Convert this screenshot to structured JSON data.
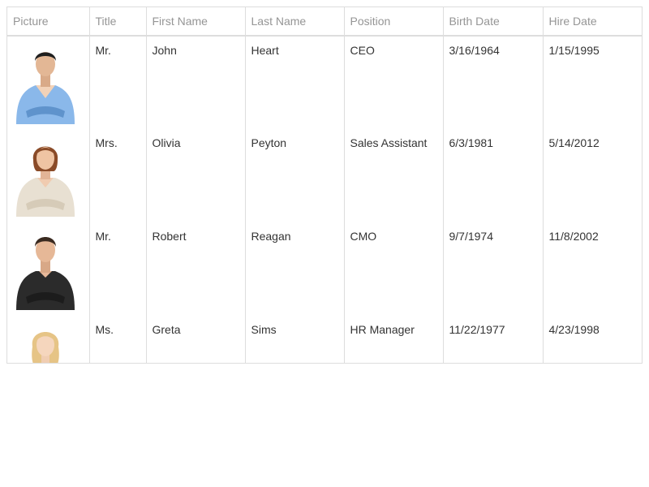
{
  "grid": {
    "columns": [
      "Picture",
      "Title",
      "First Name",
      "Last Name",
      "Position",
      "Birth Date",
      "Hire Date"
    ],
    "rows": [
      {
        "picture_icon": "employee-photo-john-heart",
        "title": "Mr.",
        "first_name": "John",
        "last_name": "Heart",
        "position": "CEO",
        "birth_date": "3/16/1964",
        "hire_date": "1/15/1995"
      },
      {
        "picture_icon": "employee-photo-olivia-peyton",
        "title": "Mrs.",
        "first_name": "Olivia",
        "last_name": "Peyton",
        "position": "Sales Assistant",
        "birth_date": "6/3/1981",
        "hire_date": "5/14/2012"
      },
      {
        "picture_icon": "employee-photo-robert-reagan",
        "title": "Mr.",
        "first_name": "Robert",
        "last_name": "Reagan",
        "position": "CMO",
        "birth_date": "9/7/1974",
        "hire_date": "11/8/2002"
      },
      {
        "picture_icon": "employee-photo-greta-sims",
        "title": "Ms.",
        "first_name": "Greta",
        "last_name": "Sims",
        "position": "HR Manager",
        "birth_date": "11/22/1977",
        "hire_date": "4/23/1998"
      }
    ]
  },
  "colors": {
    "header_text": "#959595",
    "cell_text": "#333333",
    "border": "#dddddd"
  }
}
